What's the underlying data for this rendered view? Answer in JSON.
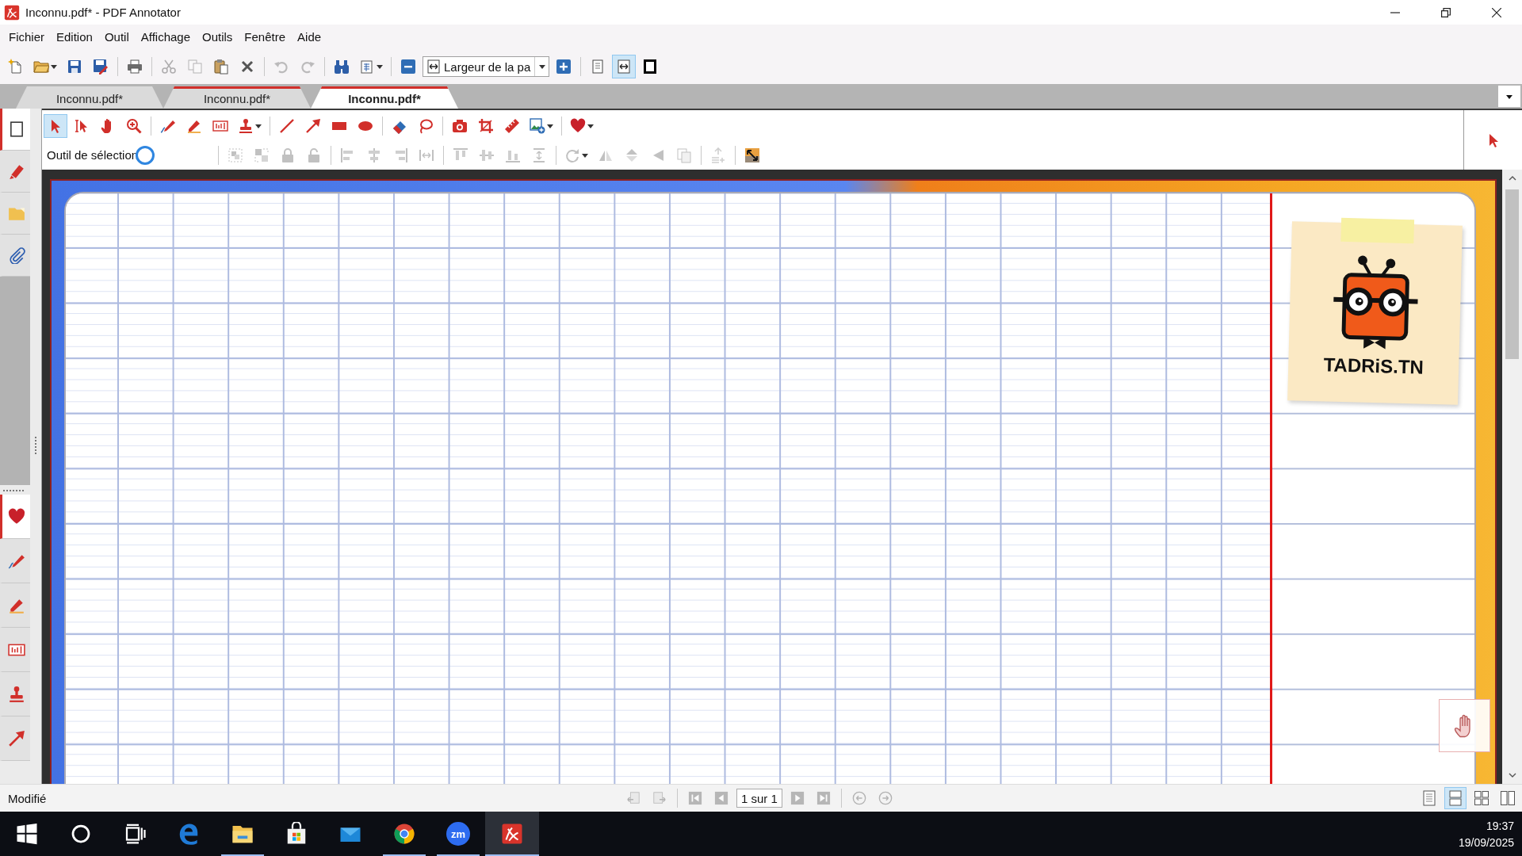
{
  "window": {
    "title": "Inconnu.pdf* - PDF Annotator"
  },
  "menu": [
    {
      "label": "Fichier"
    },
    {
      "label": "Edition"
    },
    {
      "label": "Outil"
    },
    {
      "label": "Affichage"
    },
    {
      "label": "Outils"
    },
    {
      "label": "Fenêtre"
    },
    {
      "label": "Aide"
    }
  ],
  "toolbar": {
    "groups": [
      [
        {
          "kind": "new",
          "disabled": false
        },
        {
          "kind": "open",
          "disabled": false,
          "dropdown": true
        },
        {
          "kind": "save",
          "disabled": false
        },
        {
          "kind": "save-as",
          "disabled": false
        }
      ],
      [
        {
          "kind": "print",
          "disabled": false
        }
      ],
      [
        {
          "kind": "cut",
          "disabled": true
        },
        {
          "kind": "copy",
          "disabled": true
        },
        {
          "kind": "paste",
          "disabled": false
        },
        {
          "kind": "delete",
          "disabled": false
        }
      ],
      [
        {
          "kind": "undo",
          "disabled": true
        },
        {
          "kind": "redo",
          "disabled": true
        }
      ],
      [
        {
          "kind": "find",
          "disabled": false
        },
        {
          "kind": "layout",
          "disabled": false,
          "dropdown": true
        }
      ],
      [
        {
          "kind": "zoom-out",
          "disabled": false
        },
        {
          "kind": "zoom-combo",
          "value": "Largeur de la pa"
        },
        {
          "kind": "zoom-in",
          "disabled": false
        }
      ],
      [
        {
          "kind": "page",
          "selected": false
        },
        {
          "kind": "fit-width",
          "selected": true
        },
        {
          "kind": "fullscreen",
          "selected": false
        }
      ]
    ]
  },
  "tabs": [
    {
      "label": "Inconnu.pdf*",
      "selected": false,
      "accent_line": false
    },
    {
      "label": "Inconnu.pdf*",
      "selected": false,
      "accent_line": true
    },
    {
      "label": "Inconnu.pdf*",
      "selected": true,
      "accent_line": true
    }
  ],
  "annotation_tools": {
    "tools": [
      [
        {
          "kind": "select",
          "selected": true
        },
        {
          "kind": "text-select",
          "selected": false
        },
        {
          "kind": "hand",
          "selected": false
        },
        {
          "kind": "zoom",
          "selected": false
        }
      ],
      [
        {
          "kind": "pen",
          "selected": false
        },
        {
          "kind": "highlighter",
          "selected": false
        },
        {
          "kind": "textbox",
          "selected": false
        },
        {
          "kind": "stamp",
          "selected": false,
          "dropdown": true
        }
      ],
      [
        {
          "kind": "line",
          "selected": false
        },
        {
          "kind": "arrow",
          "selected": false
        },
        {
          "kind": "rect",
          "selected": false
        },
        {
          "kind": "ellipse",
          "selected": false
        }
      ],
      [
        {
          "kind": "eraser",
          "selected": false
        },
        {
          "kind": "lasso",
          "selected": false
        }
      ],
      [
        {
          "kind": "camera",
          "selected": false
        },
        {
          "kind": "crop",
          "selected": false
        },
        {
          "kind": "ruler",
          "selected": false
        },
        {
          "kind": "image",
          "selected": false,
          "dropdown": true
        }
      ],
      [
        {
          "kind": "heart",
          "selected": false,
          "dropdown": true
        }
      ]
    ],
    "current_tool": "Outil de sélection",
    "object_tools": [
      [
        {
          "kind": "group",
          "disabled": true
        },
        {
          "kind": "ungroup",
          "disabled": true
        },
        {
          "kind": "lock",
          "disabled": true
        },
        {
          "kind": "unlock",
          "disabled": true
        }
      ],
      [
        {
          "kind": "align-left",
          "disabled": true
        },
        {
          "kind": "align-center",
          "disabled": true
        },
        {
          "kind": "align-right",
          "disabled": true
        },
        {
          "kind": "space-h",
          "disabled": true
        }
      ],
      [
        {
          "kind": "align-top",
          "disabled": true
        },
        {
          "kind": "align-middle",
          "disabled": true
        },
        {
          "kind": "align-bottom",
          "disabled": true
        },
        {
          "kind": "space-v",
          "disabled": true
        }
      ],
      [
        {
          "kind": "rotate",
          "disabled": true,
          "dropdown": true
        },
        {
          "kind": "flip-h",
          "disabled": true
        },
        {
          "kind": "flip-v",
          "disabled": true
        },
        {
          "kind": "rotate-left",
          "disabled": true
        },
        {
          "kind": "duplicate",
          "disabled": true
        }
      ],
      [
        {
          "kind": "insert",
          "disabled": true
        }
      ],
      [
        {
          "kind": "resize",
          "disabled": false
        }
      ]
    ]
  },
  "sidebar": {
    "top_tabs": [
      {
        "kind": "pages",
        "selected": true
      },
      {
        "kind": "marker",
        "selected": false
      },
      {
        "kind": "folder",
        "selected": false
      },
      {
        "kind": "attachment",
        "selected": false
      }
    ],
    "bottom_tabs": [
      {
        "kind": "heart",
        "selected": true
      },
      {
        "kind": "pen",
        "selected": false
      },
      {
        "kind": "highlighter",
        "selected": false
      },
      {
        "kind": "textbox",
        "selected": false
      },
      {
        "kind": "stamp",
        "selected": false
      },
      {
        "kind": "arrow",
        "selected": false
      }
    ]
  },
  "document": {
    "logo_text": "TADRiS.TN"
  },
  "status_bar": {
    "status": "Modifié",
    "navigation": [
      [
        {
          "kind": "prev-doc",
          "disabled": true
        },
        {
          "kind": "next-doc",
          "disabled": true
        }
      ],
      [
        {
          "kind": "first",
          "disabled": true
        },
        {
          "kind": "prev",
          "disabled": true
        },
        {
          "kind": "page-field",
          "value": "1 sur 1"
        },
        {
          "kind": "next",
          "disabled": true
        },
        {
          "kind": "last",
          "disabled": true
        }
      ],
      [
        {
          "kind": "back",
          "disabled": true
        },
        {
          "kind": "forward",
          "disabled": true
        }
      ]
    ],
    "view_modes": [
      {
        "kind": "single",
        "selected": false
      },
      {
        "kind": "continuous",
        "selected": true
      },
      {
        "kind": "grid",
        "selected": false
      },
      {
        "kind": "facing",
        "selected": false
      }
    ]
  },
  "taskbar": {
    "system": [
      {
        "kind": "start"
      },
      {
        "kind": "search"
      },
      {
        "kind": "task-view"
      }
    ],
    "apps": [
      {
        "kind": "edge",
        "running": false,
        "active": false
      },
      {
        "kind": "explorer",
        "running": true,
        "active": false
      },
      {
        "kind": "store",
        "running": false,
        "active": false
      },
      {
        "kind": "mail",
        "running": false,
        "active": false
      },
      {
        "kind": "chrome",
        "running": true,
        "active": false
      },
      {
        "kind": "zoom",
        "label": "zm",
        "running": true,
        "active": false
      },
      {
        "kind": "pdf-annotator",
        "running": true,
        "active": true
      }
    ],
    "time": "19:37",
    "date": "19/09/2025"
  }
}
